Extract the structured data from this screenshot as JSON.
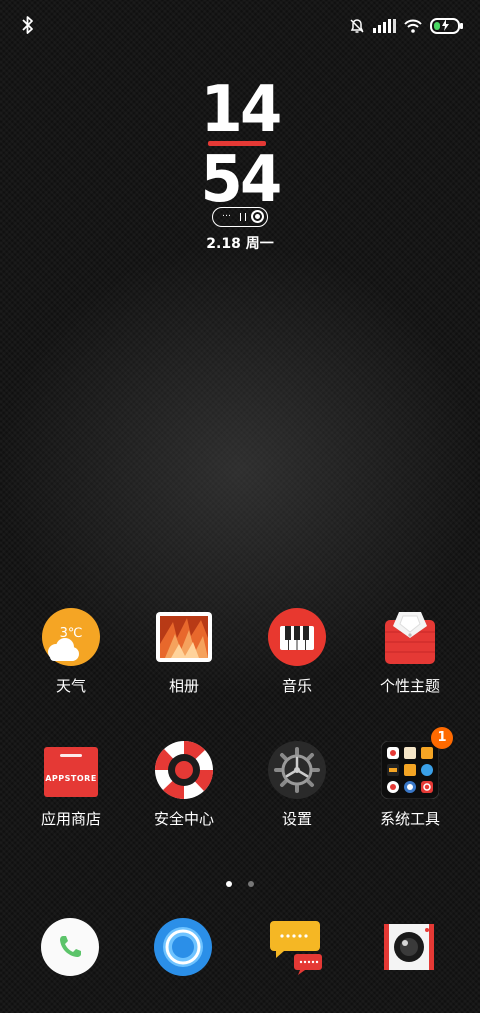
{
  "status_bar": {
    "left_icons": [
      "bluetooth-icon"
    ],
    "right_icons": [
      "silent-bell-icon",
      "signal-icon",
      "wifi-icon",
      "battery-charging-icon"
    ]
  },
  "clock": {
    "hour": "14",
    "minute": "54",
    "date": "2.18 周一",
    "pill_text": "…"
  },
  "apps": [
    {
      "label": "天气",
      "icon": "weather-icon",
      "temp": "3℃"
    },
    {
      "label": "相册",
      "icon": "gallery-icon"
    },
    {
      "label": "音乐",
      "icon": "music-icon"
    },
    {
      "label": "个性主题",
      "icon": "themes-icon"
    },
    {
      "label": "应用商店",
      "icon": "app-store-icon",
      "icon_text": "APPSTORE"
    },
    {
      "label": "安全中心",
      "icon": "security-icon"
    },
    {
      "label": "设置",
      "icon": "settings-icon"
    },
    {
      "label": "系统工具",
      "icon": "tools-folder-icon",
      "badge": "1"
    }
  ],
  "pager": {
    "pages": 2,
    "current": 1
  },
  "dock": [
    {
      "icon": "phone-icon"
    },
    {
      "icon": "browser-icon"
    },
    {
      "icon": "messages-icon"
    },
    {
      "icon": "camera-icon"
    }
  ],
  "colors": {
    "accent_red": "#e53935",
    "badge_orange": "#ff6a00",
    "battery_green": "#4cd964"
  }
}
